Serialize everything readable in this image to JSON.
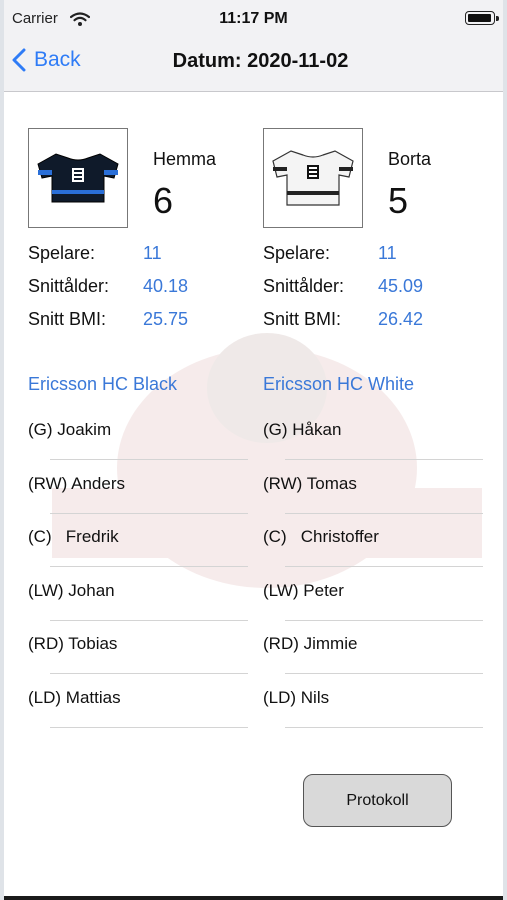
{
  "status_bar": {
    "carrier": "Carrier",
    "time": "11:17 PM"
  },
  "nav": {
    "back_label": "Back",
    "title": "Datum: 2020-11-02"
  },
  "home": {
    "side_label": "Hemma",
    "score": "6",
    "jersey_icon": "black-hockey-jersey",
    "stats": [
      {
        "label": "Spelare:",
        "value": "11"
      },
      {
        "label": "Snittålder:",
        "value": "40.18"
      },
      {
        "label": "Snitt BMI:",
        "value": "25.75"
      }
    ],
    "team_name": "Ericsson HC Black",
    "players": [
      {
        "text": "(G) Joakim"
      },
      {
        "text": "(RW) Anders"
      },
      {
        "text": "(C)   Fredrik"
      },
      {
        "text": "(LW) Johan"
      },
      {
        "text": "(RD) Tobias"
      },
      {
        "text": "(LD) Mattias"
      }
    ]
  },
  "away": {
    "side_label": "Borta",
    "score": "5",
    "jersey_icon": "white-hockey-jersey",
    "stats": [
      {
        "label": "Spelare:",
        "value": "11"
      },
      {
        "label": "Snittålder:",
        "value": "45.09"
      },
      {
        "label": "Snitt BMI:",
        "value": "26.42"
      }
    ],
    "team_name": "Ericsson HC White",
    "players": [
      {
        "text": "(G) Håkan"
      },
      {
        "text": "(RW) Tomas"
      },
      {
        "text": "(C)   Christoffer"
      },
      {
        "text": "(LW) Peter"
      },
      {
        "text": "(RD) Jimmie"
      },
      {
        "text": "(LD) Nils"
      }
    ]
  },
  "protokoll_label": "Protokoll",
  "colors": {
    "accent": "#2f7cf6",
    "value_blue": "#3a78d8",
    "nav_bg": "#f2f2f4",
    "button_bg": "#d9d9d9"
  }
}
